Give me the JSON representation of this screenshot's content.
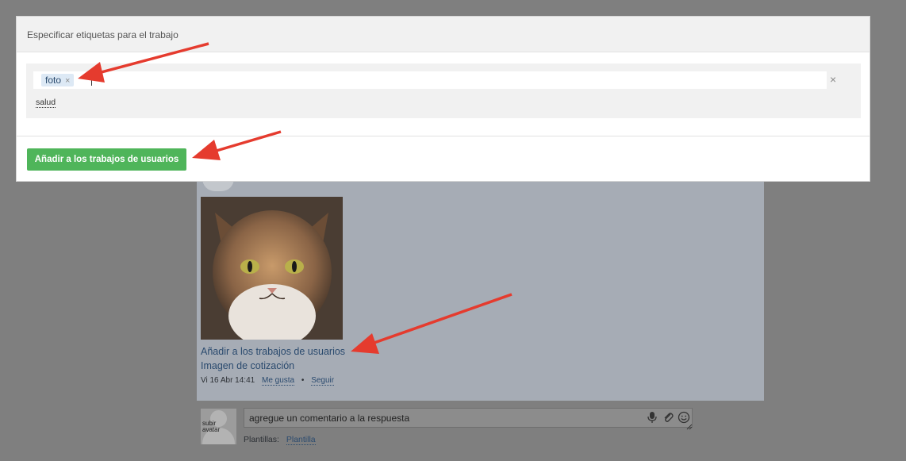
{
  "modal": {
    "title": "Especificar etiquetas para el trabajo",
    "tag_chip": "foto",
    "chip_remove": "×",
    "clear": "×",
    "suggestion": "salud",
    "primary_button": "Añadir a los trabajos de usuarios"
  },
  "feed": {
    "post_link_1": "Añadir a los trabajos de usuarios",
    "post_link_2": "Imagen de cotización",
    "meta_time": "Vi 16 Abr 14:41",
    "meta_like": "Me gusta",
    "meta_separator": "•",
    "meta_follow": "Seguir"
  },
  "comment": {
    "avatar_text": "subir avatar",
    "placeholder": "agregue un comentario a la respuesta",
    "templates_label": "Plantillas:",
    "templates_link": "Plantilla"
  },
  "colors": {
    "overlay": "#7f7f7f",
    "primary_button": "#4fb55a",
    "chip_bg": "#dde9f5",
    "annotation_arrow": "#e53b2e"
  },
  "icons": [
    "microphone-icon",
    "paperclip-icon",
    "smiley-icon",
    "resize-handle-icon",
    "close-icon"
  ]
}
